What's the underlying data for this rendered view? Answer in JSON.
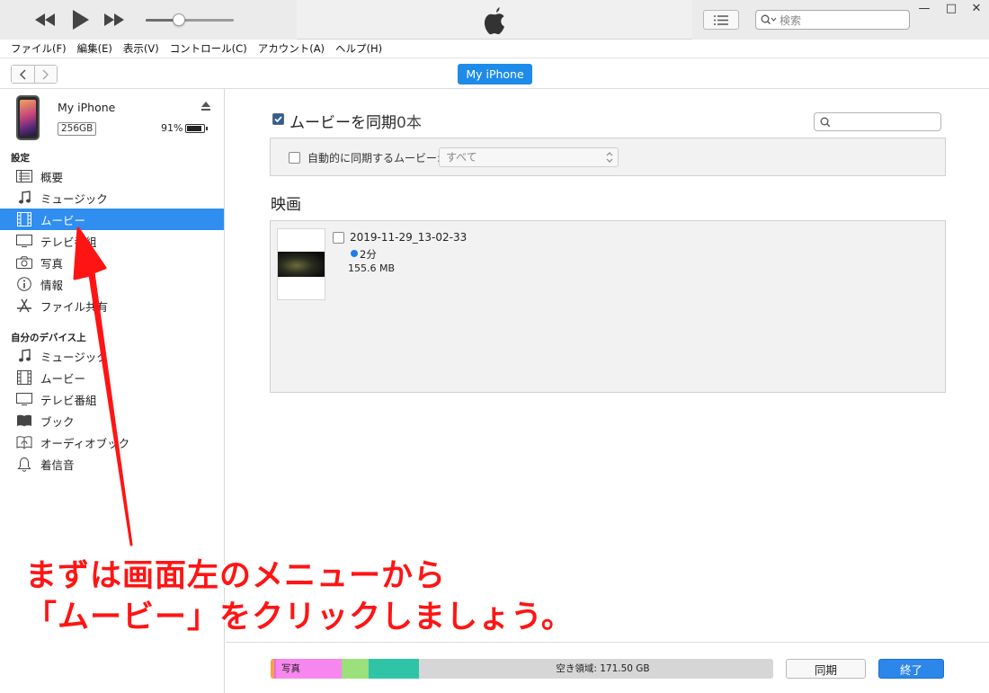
{
  "search": {
    "placeholder": "検索"
  },
  "window": {
    "minimize": "—",
    "maximize": "□",
    "close": "✕"
  },
  "menu": [
    "ファイル(F)",
    "編集(E)",
    "表示(V)",
    "コントロール(C)",
    "アカウント(A)",
    "ヘルプ(H)"
  ],
  "player": {
    "volume": 0.38
  },
  "nav": {
    "device_label": "My iPhone"
  },
  "device": {
    "name": "My iPhone",
    "capacity": "256GB",
    "battery_text": "91%",
    "battery_level": 0.91
  },
  "sidebar": {
    "settings_title": "設定",
    "settings_items": [
      {
        "label": "概要",
        "icon": "summary-icon"
      },
      {
        "label": "ミュージック",
        "icon": "music-note-icon"
      },
      {
        "label": "ムービー",
        "icon": "film-icon",
        "selected": true
      },
      {
        "label": "テレビ番組",
        "icon": "tv-icon"
      },
      {
        "label": "写真",
        "icon": "camera-icon"
      },
      {
        "label": "情報",
        "icon": "info-icon"
      },
      {
        "label": "ファイル共有",
        "icon": "app-store-icon"
      }
    ],
    "ondevice_title": "自分のデバイス上",
    "ondevice_items": [
      {
        "label": "ミュージック",
        "icon": "music-note-icon"
      },
      {
        "label": "ムービー",
        "icon": "film-icon"
      },
      {
        "label": "テレビ番組",
        "icon": "tv-icon"
      },
      {
        "label": "ブック",
        "icon": "book-icon"
      },
      {
        "label": "オーディオブック",
        "icon": "audiobook-icon"
      },
      {
        "label": "着信音",
        "icon": "bell-icon"
      }
    ]
  },
  "main": {
    "sync_label": "ムービーを同期",
    "sync_count": "0本",
    "auto_sync_label": "自動的に同期するムービー:",
    "auto_sync_value": "すべて",
    "movies_title": "映画",
    "movies": [
      {
        "name": "2019-11-29_13-02-33",
        "duration": "2分",
        "size": "155.6 MB"
      }
    ]
  },
  "storage": {
    "photos_label": "写真",
    "free_label": "空き領域: 171.50 GB",
    "segments": [
      {
        "color": "#f3a14b",
        "fraction": 0.007
      },
      {
        "color": "#f06bd4",
        "fraction": 0.004
      },
      {
        "color": "#f787ee",
        "fraction": 0.13
      },
      {
        "color": "#9ae07b",
        "fraction": 0.053
      },
      {
        "color": "#2fc4a6",
        "fraction": 0.1
      }
    ]
  },
  "buttons": {
    "sync": "同期",
    "done": "終了"
  },
  "annotation": {
    "line1": "まずは画面左のメニューから",
    "line2": "「ムービー」をクリックしましょう。",
    "color": "#ff1414"
  },
  "colors": {
    "accent": "#2f8ef0",
    "pill": "#1e8be8"
  }
}
